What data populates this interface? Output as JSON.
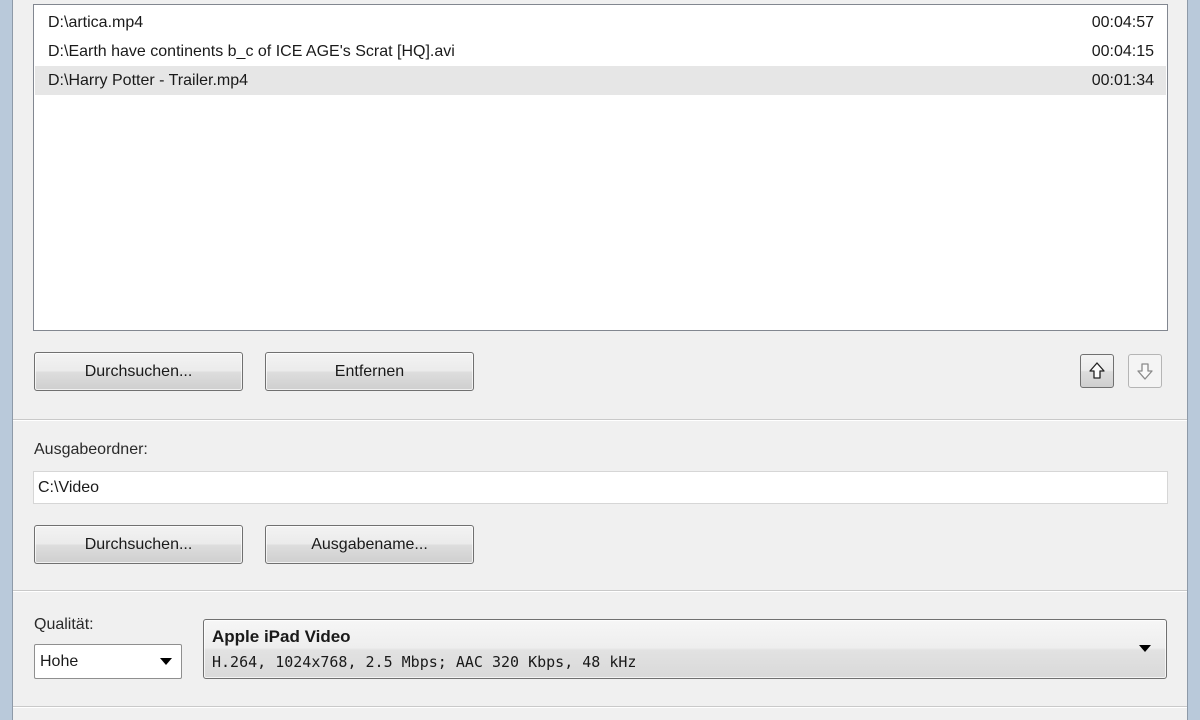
{
  "files": [
    {
      "path": "D:\\artica.mp4",
      "duration": "00:04:57",
      "selected": false
    },
    {
      "path": "D:\\Earth have continents b_c of ICE AGE's Scrat [HQ].avi",
      "duration": "00:04:15",
      "selected": false
    },
    {
      "path": "D:\\Harry Potter - Trailer.mp4",
      "duration": "00:01:34",
      "selected": true
    }
  ],
  "list_buttons": {
    "browse_label": "Durchsuchen...",
    "remove_label": "Entfernen",
    "move_up_icon": "arrow-up-icon",
    "move_down_icon": "arrow-down-icon"
  },
  "output": {
    "folder_label": "Ausgabeordner:",
    "folder_value": "C:\\Video",
    "browse_label": "Durchsuchen...",
    "output_name_label": "Ausgabename..."
  },
  "quality": {
    "label": "Qualität:",
    "selected": "Hohe",
    "preset_title": "Apple iPad Video",
    "preset_desc": "H.264, 1024x768, 2.5 Mbps; AAC 320 Kbps, 48 kHz"
  }
}
